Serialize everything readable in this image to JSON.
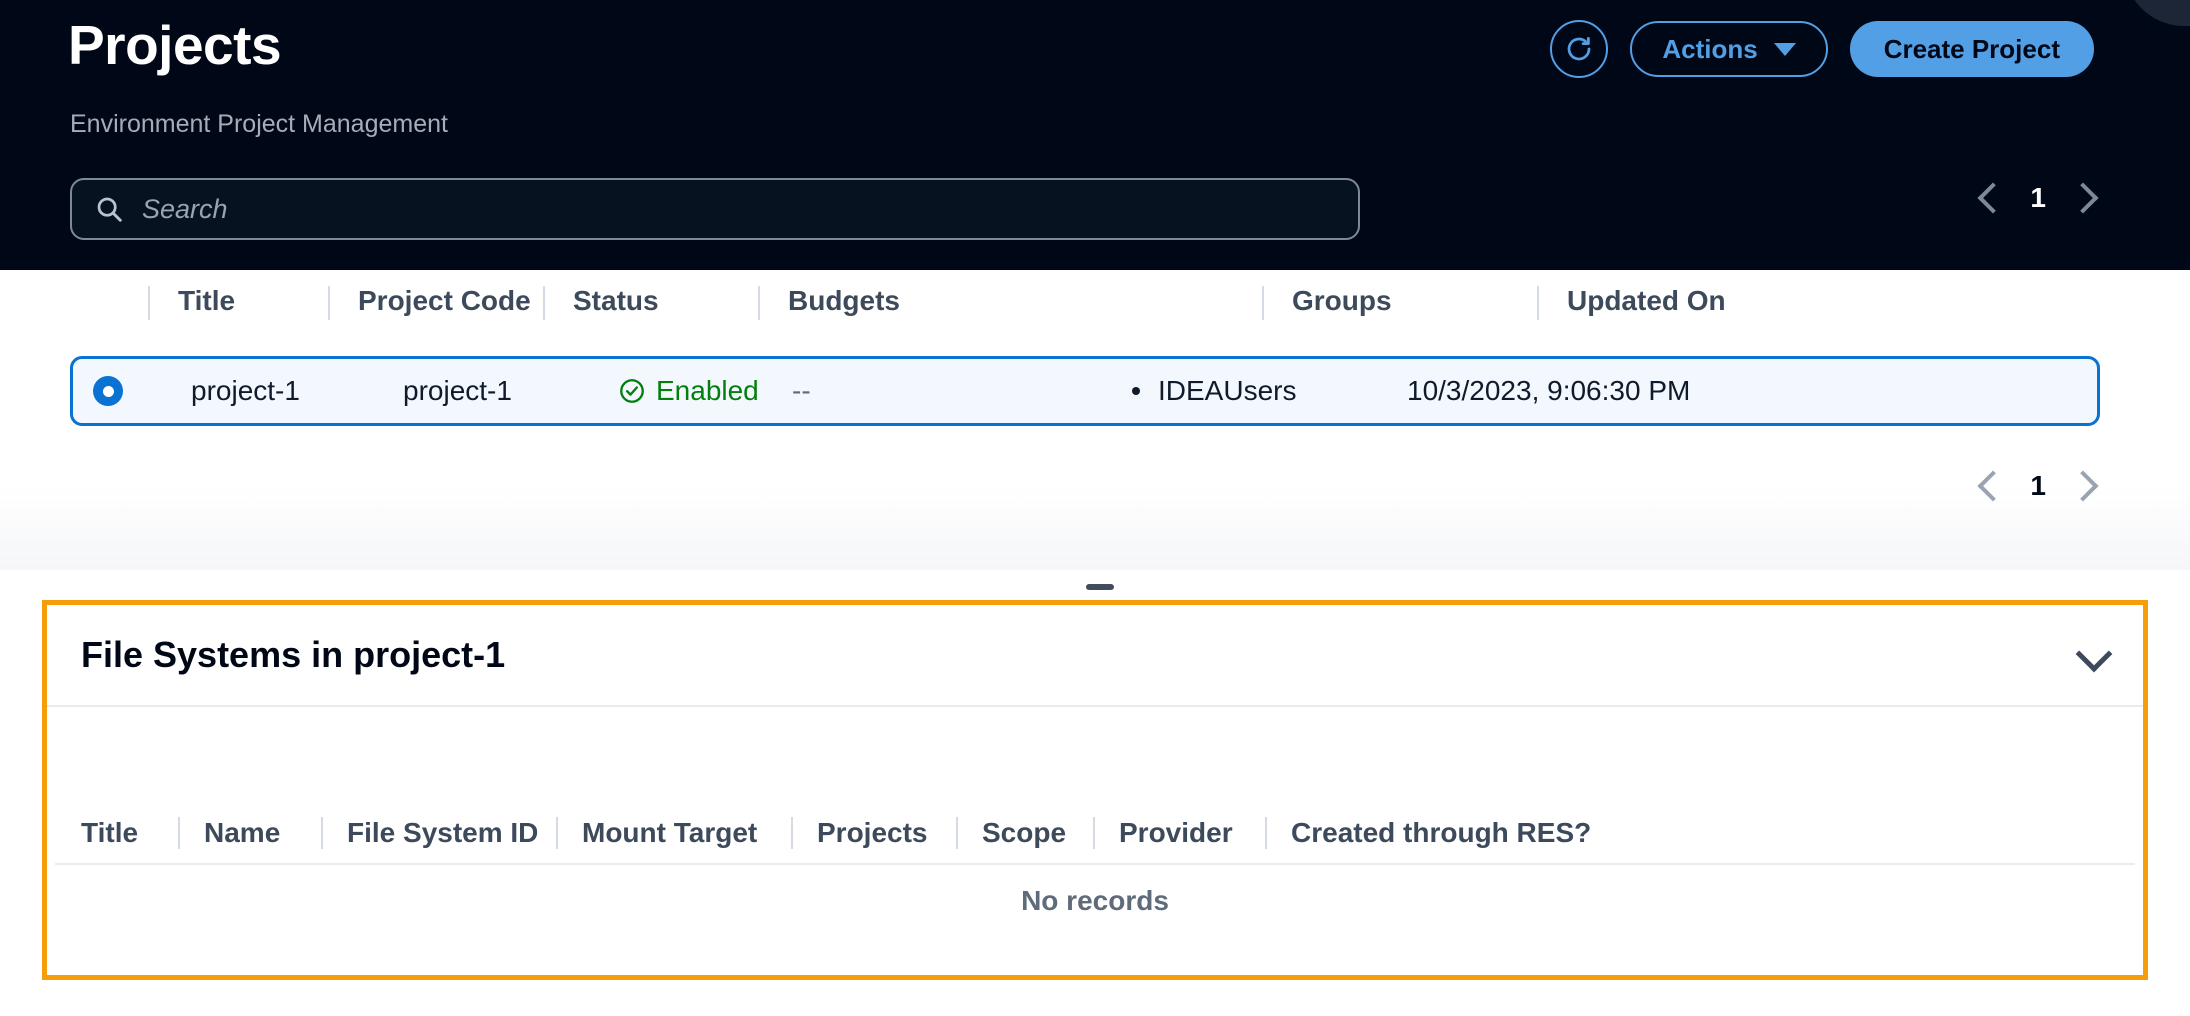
{
  "header": {
    "title": "Projects",
    "subtitle": "Environment Project Management",
    "refresh_icon": "refresh-icon",
    "actions_label": "Actions",
    "create_label": "Create Project",
    "accent_blue": "#539fe5",
    "background": "#000716"
  },
  "search": {
    "placeholder": "Search",
    "value": "",
    "icon": "search-icon"
  },
  "pagination_top": {
    "prev_icon": "chevron-left-icon",
    "page": "1",
    "next_icon": "chevron-right-icon"
  },
  "pagination_bottom": {
    "prev_icon": "chevron-left-icon",
    "page": "1",
    "next_icon": "chevron-right-icon"
  },
  "projects_table": {
    "columns": [
      "Title",
      "Project Code",
      "Status",
      "Budgets",
      "Groups",
      "Updated On"
    ],
    "rows": [
      {
        "selected": true,
        "title": "project-1",
        "project_code": "project-1",
        "status": "Enabled",
        "status_icon": "check-circle-icon",
        "status_color": "#037f0c",
        "budgets": "--",
        "groups": "IDEAUsers",
        "updated_on": "10/3/2023, 9:06:30 PM"
      }
    ]
  },
  "file_systems_panel": {
    "title": "File Systems in project-1",
    "collapse_icon": "chevron-down-icon",
    "highlight_color": "#f59d0a",
    "columns": [
      "Title",
      "Name",
      "File System ID",
      "Mount Target",
      "Projects",
      "Scope",
      "Provider",
      "Created through RES?"
    ],
    "empty_text": "No records"
  }
}
